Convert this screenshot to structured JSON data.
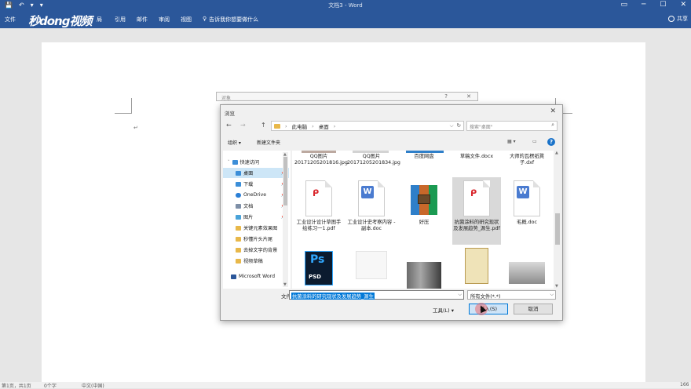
{
  "window": {
    "title": "文档3 - Word"
  },
  "quick_access": {
    "save": "💾",
    "undo": "↶",
    "undo_more": "▾",
    "customize": "▾"
  },
  "window_controls": {
    "ribbon_options": "▭",
    "minimize": "─",
    "maximize": "☐",
    "close": "✕"
  },
  "ribbon": {
    "tabs": [
      "文件",
      "引用",
      "邮件",
      "审阅",
      "视图"
    ],
    "tab_partial": "局",
    "logo": "秒dong视频",
    "tell_me": "告诉我你想要做什么",
    "share": "共享"
  },
  "background_dialog": {
    "title": "对象",
    "help": "?",
    "close": "✕"
  },
  "dialog": {
    "title": "浏览",
    "close": "✕",
    "nav": {
      "back": "←",
      "forward": "→",
      "up": "↑"
    },
    "address": {
      "crumbs": [
        "此电脑",
        "桌面"
      ],
      "sep": "›",
      "dropdown": "⌵",
      "refresh": "↻"
    },
    "search_placeholder": "搜索\"桌面\"",
    "search_icon": "⌕",
    "toolbar": {
      "organize": "组织 ▾",
      "new_folder": "新建文件夹",
      "view": "▦ ▾",
      "pane": "▭",
      "help": "?"
    },
    "nav_pane": [
      {
        "label": "快速访问",
        "icon": "star",
        "color": "#3b8ed8"
      },
      {
        "label": "桌面",
        "icon": "desktop",
        "color": "#3b8ed8",
        "pinned": true,
        "selected": true
      },
      {
        "label": "下载",
        "icon": "download",
        "color": "#3b8ed8",
        "pinned": true
      },
      {
        "label": "OneDrive",
        "icon": "cloud",
        "color": "#2a7fd6",
        "pinned": true
      },
      {
        "label": "文档",
        "icon": "doc",
        "color": "#7e8fa7",
        "pinned": true
      },
      {
        "label": "图片",
        "icon": "picture",
        "color": "#4aa3d9",
        "pinned": true
      },
      {
        "label": "关键元素效果图",
        "icon": "folder",
        "color": "#e8b84a"
      },
      {
        "label": "秒懂片头片尾",
        "icon": "folder",
        "color": "#e8b84a"
      },
      {
        "label": "去掉文字的背景",
        "icon": "folder",
        "color": "#e8b84a"
      },
      {
        "label": "视频草稿",
        "icon": "folder",
        "color": "#e8b84a"
      },
      {
        "label": "Microsoft Word",
        "icon": "word",
        "color": "#2b579a"
      }
    ],
    "pin_glyph": "📌",
    "files_row1": [
      {
        "name": "QQ图片20171205201816.jpg"
      },
      {
        "name": "QQ图片20171205201834.jpg"
      },
      {
        "name": "百度网盘"
      },
      {
        "name": "草稿文件.docx"
      },
      {
        "name": "大师的瓦楞纸凳子.dxf"
      }
    ],
    "files_row2": [
      {
        "name": "工业设计设计草图手绘练习一1.pdf",
        "type": "pdf"
      },
      {
        "name": "工业设计史考察内容 - 副本.doc",
        "type": "word"
      },
      {
        "name": "好压",
        "type": "rar"
      },
      {
        "name": "抗菌涂料的研究现状及发展趋势_源生.pdf",
        "type": "pdf",
        "selected": true
      },
      {
        "name": "毛概.doc",
        "type": "word"
      }
    ],
    "files_row3": [
      {
        "type": "psd",
        "t1": "Ps",
        "t2": "PSD"
      },
      {
        "type": "sketch"
      },
      {
        "type": "photo"
      },
      {
        "type": "certificate"
      },
      {
        "type": "car"
      }
    ],
    "pdf_glyph": "ᑭ",
    "word_glyph": "W",
    "scroll": {
      "up": "▲",
      "down": "▼"
    },
    "filename_label": "文件名(N):",
    "filename_value": "抗菌涂料的研究现状及发展趋势_源生",
    "filetype_value": "所有文件(*.*)",
    "dropdown": "⌵",
    "tools": "工具(L) ▾",
    "insert_button": "插入(S)",
    "cancel_button": "取消"
  },
  "statusbar": {
    "page": "第1页，共1页",
    "words": "0个字",
    "lang": "中文(中国)",
    "zoom": "166"
  },
  "colors": {
    "accent": "#2b579a",
    "selection": "#0078d7"
  }
}
